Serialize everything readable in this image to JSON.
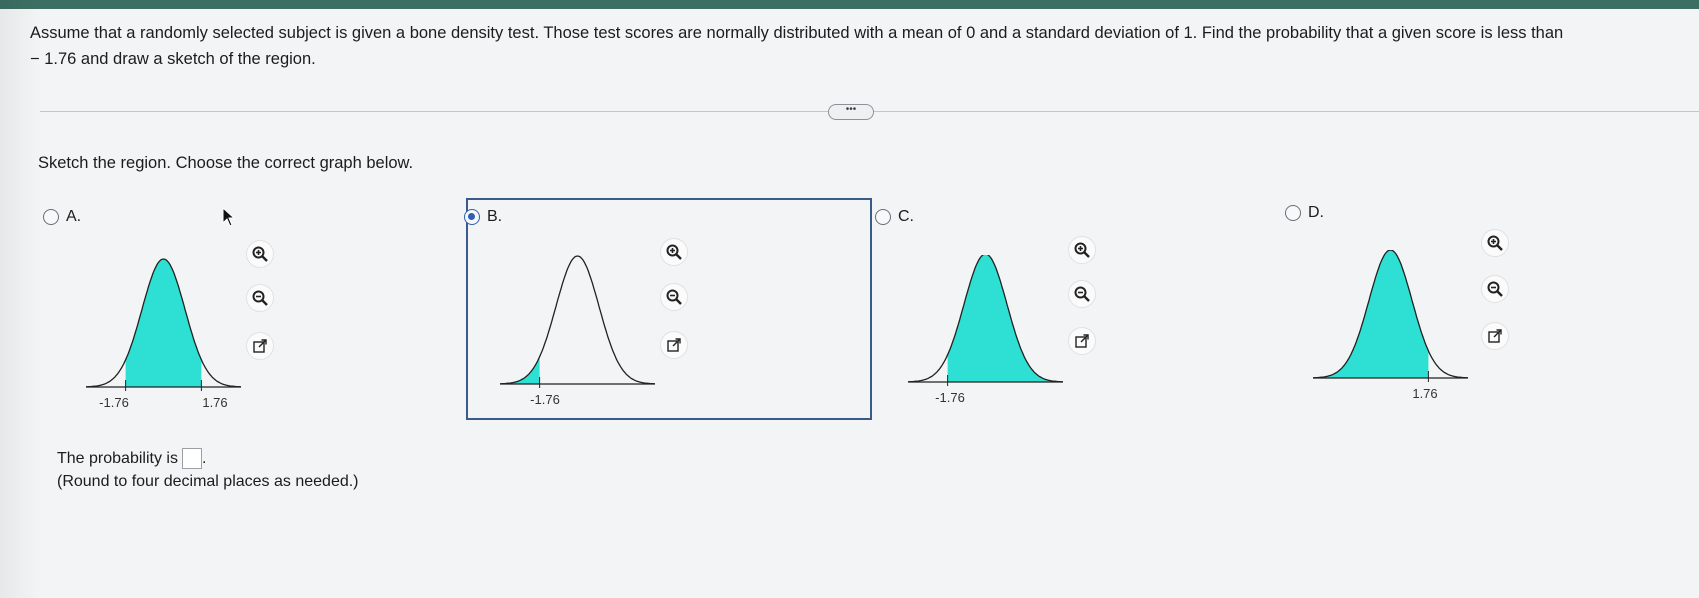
{
  "question": {
    "line1": "Assume that a randomly selected subject is given a bone density test. Those test scores are normally distributed with a mean of 0 and a standard deviation of 1. Find the probability that a given score is less than",
    "line2": "− 1.76 and draw a sketch of the region."
  },
  "more_button": "•••",
  "instruction": "Sketch the region. Choose the correct graph below.",
  "options": [
    {
      "label": "A.",
      "selected": false,
      "tick_left": "-1.76",
      "tick_right": "1.76",
      "shading": "between -1.76 and 1.76"
    },
    {
      "label": "B.",
      "selected": true,
      "tick_left": "-1.76",
      "shading": "left of -1.76"
    },
    {
      "label": "C.",
      "selected": false,
      "tick_left": "-1.76",
      "shading": "right of -1.76"
    },
    {
      "label": "D.",
      "selected": false,
      "tick_right": "1.76",
      "shading": "left of 1.76"
    }
  ],
  "tools": [
    "zoom-in-icon",
    "zoom-out-icon",
    "open-new-window-icon"
  ],
  "answer": {
    "prefix": "The probability is",
    "value": "",
    "suffix": ".",
    "note": "(Round to four decimal places as needed.)"
  },
  "colors": {
    "shade": "#2ee0d3",
    "accent": "#2f5fb3",
    "topbar": "#3c6f63"
  }
}
